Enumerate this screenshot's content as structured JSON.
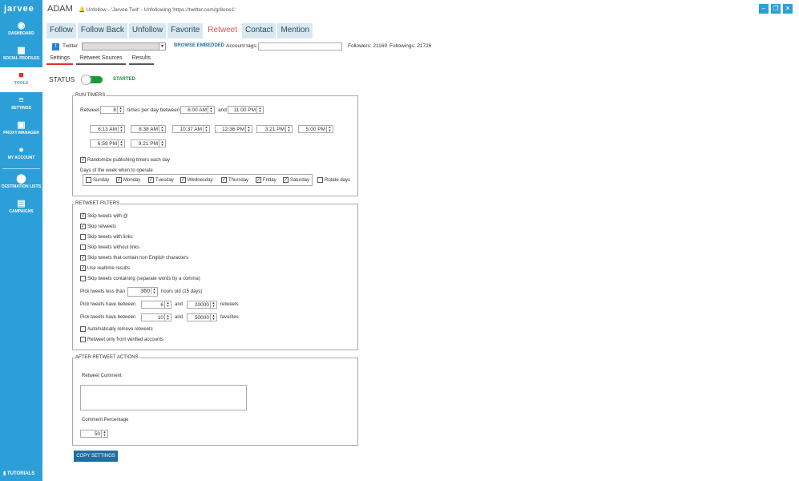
{
  "sidebar": {
    "logo": "jarvee",
    "items": [
      {
        "label": "DASHBOARD",
        "icon": "dashboard-icon"
      },
      {
        "label": "SOCIAL PROFILES",
        "icon": "profiles-icon"
      },
      {
        "label": "TOOLS",
        "icon": "tools-icon"
      },
      {
        "label": "SETTINGS",
        "icon": "settings-icon"
      },
      {
        "label": "PROXY MANAGER",
        "icon": "lock-icon"
      },
      {
        "label": "MY ACCOUNT",
        "icon": "user-icon"
      },
      {
        "label": "DESTINATION LISTS",
        "icon": "pin-icon"
      },
      {
        "label": "CAMPAIGNS",
        "icon": "calendar-icon"
      }
    ],
    "tutorials": "TUTORIALS"
  },
  "header": {
    "title": "ADAM",
    "subtitle": "Unfollow - 'Jarvee Twit' - Unfollowing 'https://twitter.com/gr8one1'"
  },
  "tabs": [
    "Follow",
    "Follow Back",
    "Unfollow",
    "Favorite",
    "Retweet",
    "Contact",
    "Mention"
  ],
  "account": {
    "network": "Twitter",
    "browse": "BROWSE EMBEDDED",
    "tags_label": "Account tags:",
    "followers": "Followers: 21169",
    "followings": "Followings: 21726"
  },
  "subtabs": [
    "Settings",
    "Retweet Sources",
    "Results"
  ],
  "status": {
    "label": "STATUS",
    "state": "STARTED"
  },
  "run_timers": {
    "title": "RUN TIMERS",
    "retweet_label": "Retweet",
    "count": "8",
    "per_day_label": "times per day between",
    "start": "6:00 AM",
    "and_label": "and",
    "end": "11:00 PM",
    "times": [
      "6:13 AM",
      "8:38 AM",
      "10:37 AM",
      "12:36 PM",
      "3:21 PM",
      "5:00 PM",
      "6:59 PM",
      "9:21 PM"
    ],
    "randomize": "Randomize publishing timers each day",
    "days_label": "Days of the week when to operate",
    "days": [
      {
        "name": "Sunday",
        "checked": false
      },
      {
        "name": "Monday",
        "checked": true
      },
      {
        "name": "Tuesday",
        "checked": true
      },
      {
        "name": "Wednesday",
        "checked": true
      },
      {
        "name": "Thursday",
        "checked": true
      },
      {
        "name": "Friday",
        "checked": true
      },
      {
        "name": "Saturday",
        "checked": true
      }
    ],
    "rotate": "Rotate days"
  },
  "filters": {
    "title": "RETWEET FILTERS",
    "checks": [
      {
        "label": "Skip tweets with @",
        "checked": true
      },
      {
        "label": "Skip retweets",
        "checked": true
      },
      {
        "label": "Skip tweets with links",
        "checked": false
      },
      {
        "label": "Skip tweets without links",
        "checked": false
      },
      {
        "label": "Skip tweets that contain non English characters",
        "checked": true
      },
      {
        "label": "Use realtime results",
        "checked": true
      },
      {
        "label": "Skip tweets containing (separate words by a comma)",
        "checked": false
      }
    ],
    "pick_less_label": "Pick tweets less than",
    "hours": "360",
    "hours_label": "hours old (15 days)",
    "between_label": "Pick tweets have between",
    "rt_min": "6",
    "rt_max": "20000",
    "rt_unit": "retweets",
    "fav_min": "10",
    "fav_max": "50000",
    "fav_unit": "favorites",
    "and_label": "and",
    "auto_remove": "Automatically remove retweets",
    "verified_only": "Retweet only from verified accounts"
  },
  "after": {
    "title": "AFTER RETWEET ACTIONS",
    "comment_label": "Retweet Comment",
    "pct_label": "Comment Percentage",
    "pct": "50"
  },
  "copy_button": "COPY SETTINGS"
}
